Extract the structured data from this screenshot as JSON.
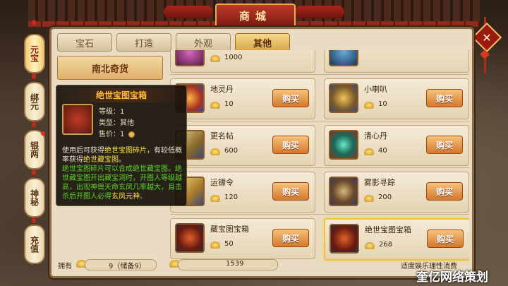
{
  "header": {
    "title": "商城"
  },
  "side_tabs": [
    {
      "label": "元宝",
      "active": true
    },
    {
      "label": "绑元",
      "active": false
    },
    {
      "label": "银两",
      "active": false,
      "badge": true
    },
    {
      "label": "神秘",
      "active": false
    },
    {
      "label": "充值",
      "active": false
    }
  ],
  "tabs": [
    {
      "label": "宝石",
      "active": false
    },
    {
      "label": "打造",
      "active": false
    },
    {
      "label": "外观",
      "active": false
    },
    {
      "label": "其他",
      "active": true
    }
  ],
  "category": {
    "label": "南北奇货"
  },
  "items": [
    {
      "name": "",
      "price": "1000",
      "buy": "",
      "partial": true,
      "color": "#9a2a6a"
    },
    {
      "name": "",
      "price": "",
      "buy": "",
      "partial": true,
      "color": "#2a6a9a"
    },
    {
      "name": "地灵丹",
      "price": "10",
      "buy": "购买",
      "color": "#d05a1a"
    },
    {
      "name": "小喇叭",
      "price": "10",
      "buy": "购买",
      "color": "#c9922a"
    },
    {
      "name": "更名帖",
      "price": "600",
      "buy": "购买",
      "color": "#b89a5a"
    },
    {
      "name": "清心丹",
      "price": "40",
      "buy": "购买",
      "color": "#3a9a7a"
    },
    {
      "name": "运镖令",
      "price": "120",
      "buy": "购买",
      "color": "#c8a23a"
    },
    {
      "name": "雾影寻踪",
      "price": "200",
      "buy": "购买",
      "color": "#8a6a3a"
    },
    {
      "name": "藏宝图宝箱",
      "price": "50",
      "buy": "购买",
      "color": "#a8321c"
    },
    {
      "name": "绝世宝图宝箱",
      "price": "268",
      "buy": "购买",
      "color": "#a8321c",
      "selected": true
    }
  ],
  "tooltip": {
    "title": "绝世宝图宝箱",
    "level": "等级：1",
    "type": "类型：其他",
    "price_label": "售价：",
    "price_value": "1",
    "desc1_a": "使用后可获得",
    "desc1_b": "绝世宝图碎片",
    "desc1_c": "，有较低概率获得",
    "desc1_d": "绝世藏宝图",
    "desc1_e": "。",
    "desc2": "绝世宝图碎片可以合成绝世藏宝图。绝世藏宝图开出藏宝洞时，开图人等级越高，出现神兽天命玄凤几率越大，且击杀后开图人必得",
    "desc2_highlight": "玄凤元神",
    "desc2_end": "。",
    "colors": {
      "title": "#ffb93a",
      "highlight": "#ffe23a",
      "green": "#5cd22a"
    }
  },
  "bottom": {
    "own_label": "拥有",
    "ingot_value": "9（储备9）",
    "bound_value": "1539",
    "notice": "适度娱乐理性消费"
  },
  "watermark": "奎亿网络策划"
}
